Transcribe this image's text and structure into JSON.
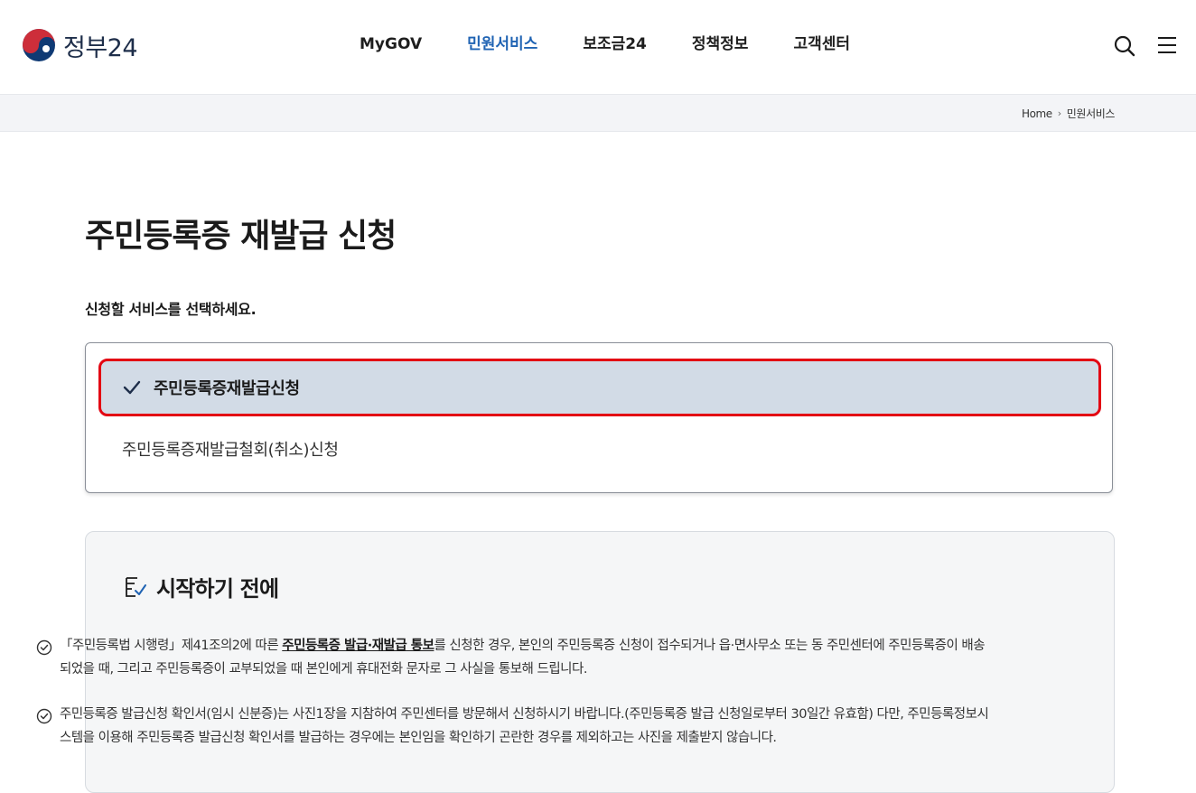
{
  "header": {
    "logo_text": "정부24",
    "nav": [
      {
        "label": "MyGOV",
        "active": false
      },
      {
        "label": "민원서비스",
        "active": true
      },
      {
        "label": "보조금24",
        "active": false
      },
      {
        "label": "정책정보",
        "active": false
      },
      {
        "label": "고객센터",
        "active": false
      }
    ],
    "icons": [
      "search-icon",
      "menu-icon"
    ]
  },
  "breadcrumb": {
    "home": "Home",
    "current": "민원서비스"
  },
  "page": {
    "title": "주민등록증 재발급 신청",
    "select_guide": "신청할 서비스를 선택하세요."
  },
  "services": {
    "selected": "주민등록증재발급신청",
    "other": "주민등록증재발급철회(취소)신청"
  },
  "notice": {
    "title": "시작하기 전에",
    "item1_pre": "「주민등록법 시행령」제41조의2에 따른 ",
    "item1_bold": "주민등록증 발급·재발급 통보",
    "item1_post": "를 신청한 경우, 본인의 주민등록증 신청이 접수되거나 읍·면사무소 또는 동 주민센터에 주민등록증이 배송되었을 때, 그리고 주민등록증이 교부되었을 때 본인에게 휴대전화 문자로 그 사실을 통보해 드립니다.",
    "item2": "주민등록증 발급신청 확인서(임시 신분증)는 사진1장을 지참하여 주민센터를 방문해서 신청하시기 바랍니다.(주민등록증 발급 신청일로부터 30일간 유효함) 다만, 주민등록정보시스템을 이용해 주민등록증 발급신청 확인서를 발급하는 경우에는 본인임을 확인하기 곤란한 경우를 제외하고는 사진을 제출받지 않습니다."
  },
  "colors": {
    "accent_blue": "#1f63b3",
    "selected_bg": "#d2dbe6",
    "highlight_red": "#e30613",
    "logo_red": "#cd2e3a",
    "logo_blue": "#0f3a74"
  }
}
